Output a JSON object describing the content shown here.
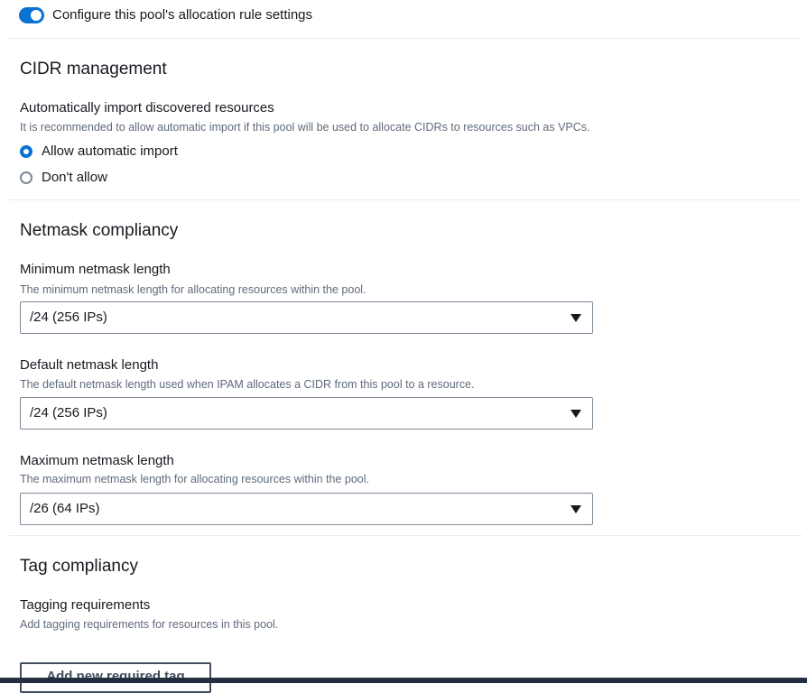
{
  "allocation_toggle": {
    "label": "Configure this pool's allocation rule settings",
    "checked": true
  },
  "cidr_management": {
    "title": "CIDR management",
    "import_label": "Automatically import discovered resources",
    "import_description": "It is recommended to allow automatic import if this pool will be used to allocate CIDRs to resources such as VPCs.",
    "options": [
      {
        "label": "Allow automatic import",
        "selected": true
      },
      {
        "label": "Don't allow",
        "selected": false
      }
    ]
  },
  "netmask_compliancy": {
    "title": "Netmask compliancy",
    "minimum": {
      "label": "Minimum netmask length",
      "description": "The minimum netmask length for allocating resources within the pool.",
      "value": "/24 (256 IPs)"
    },
    "default": {
      "label": "Default netmask length",
      "description": "The default netmask length used when IPAM allocates a CIDR from this pool to a resource.",
      "value": "/24 (256 IPs)"
    },
    "maximum": {
      "label": "Maximum netmask length",
      "description": "The maximum netmask length for allocating resources within the pool.",
      "value": "/26 (64 IPs)"
    }
  },
  "tag_compliancy": {
    "title": "Tag compliancy",
    "requirements_label": "Tagging requirements",
    "requirements_description": "Add tagging requirements for resources in this pool.",
    "add_button_label": "Add new required tag"
  },
  "colors": {
    "accent": "#0972d3",
    "text": "#16191f",
    "secondary_text": "#5f6b7a",
    "border": "#7d8998"
  }
}
